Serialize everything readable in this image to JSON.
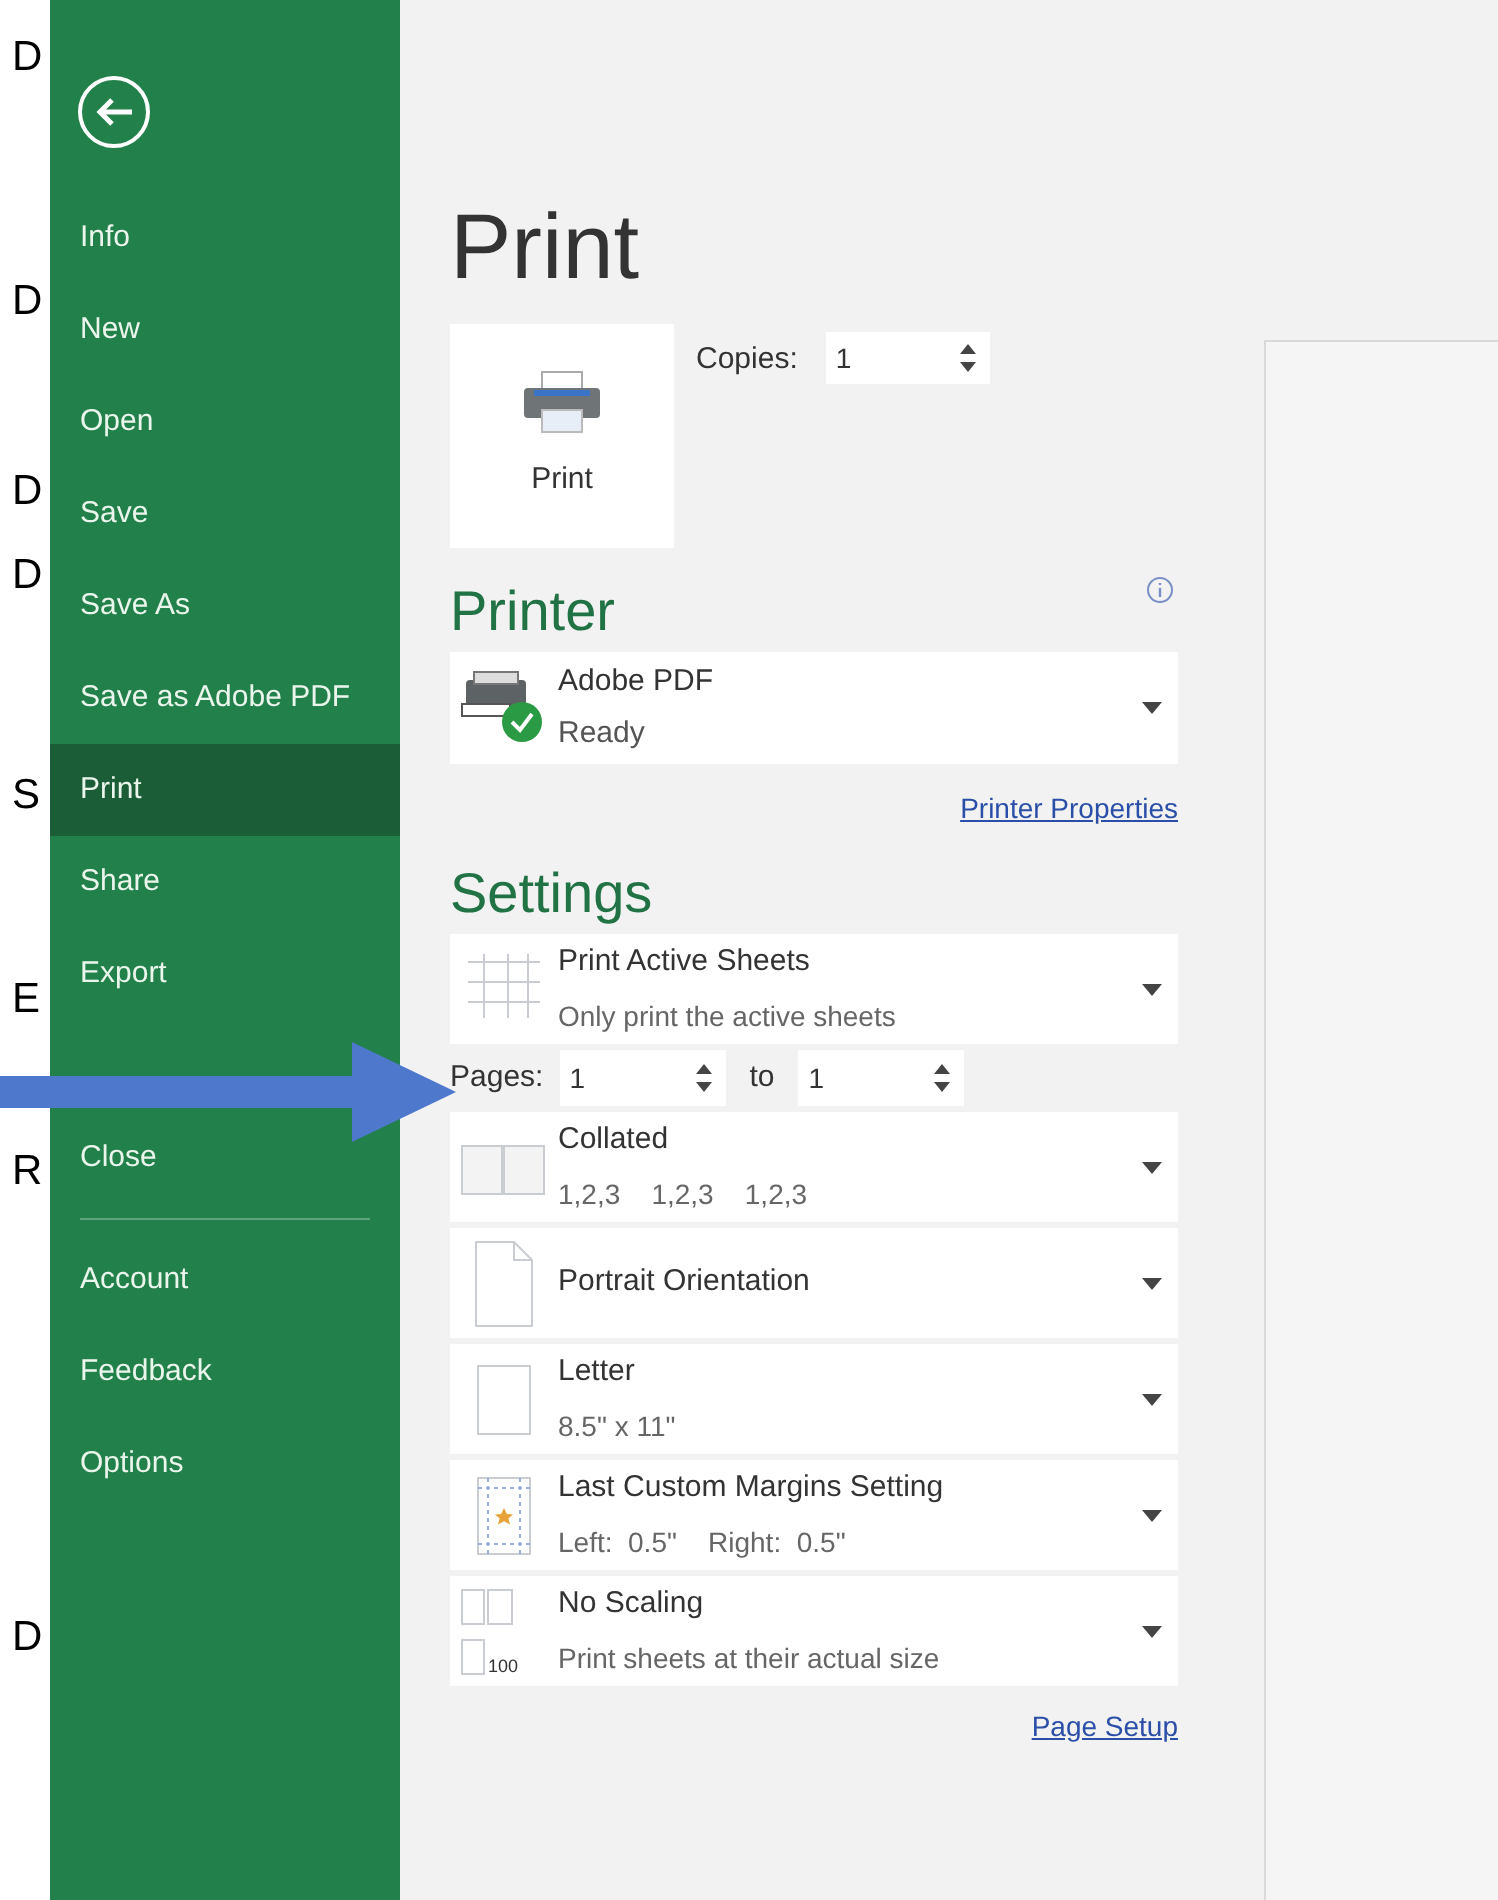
{
  "sheet_column": [
    "D",
    "D",
    "D",
    "D",
    "S",
    "E",
    "R",
    "D"
  ],
  "backstage_menu": {
    "items": [
      {
        "label": "Info",
        "selected": false
      },
      {
        "label": "New",
        "selected": false
      },
      {
        "label": "Open",
        "selected": false
      },
      {
        "label": "Save",
        "selected": false
      },
      {
        "label": "Save As",
        "selected": false
      },
      {
        "label": "Save as Adobe PDF",
        "selected": false
      },
      {
        "label": "Print",
        "selected": true
      },
      {
        "label": "Share",
        "selected": false
      },
      {
        "label": "Export",
        "selected": false
      },
      {
        "label": "Close",
        "selected": false
      }
    ],
    "bottom_items": [
      {
        "label": "Account",
        "selected": false
      },
      {
        "label": "Feedback",
        "selected": false
      },
      {
        "label": "Options",
        "selected": false
      }
    ]
  },
  "title": "Print",
  "print_button": {
    "label": "Print"
  },
  "copies": {
    "label": "Copies:",
    "value": "1"
  },
  "printer": {
    "heading": "Printer",
    "name": "Adobe PDF",
    "status": "Ready",
    "properties_link": "Printer Properties"
  },
  "settings": {
    "heading": "Settings",
    "items": [
      {
        "kind": "dropdown",
        "title": "Print Active Sheets",
        "subtitle": "Only print the active sheets"
      },
      {
        "kind": "range",
        "label": "Pages:",
        "from": "1",
        "separator": "to",
        "to": "1"
      },
      {
        "kind": "dropdown",
        "title": "Collated",
        "subtitle": "1,2,3    1,2,3    1,2,3"
      },
      {
        "kind": "dropdown",
        "title": "Portrait Orientation"
      },
      {
        "kind": "dropdown",
        "title": "Letter",
        "subtitle": "8.5\" x 11\""
      },
      {
        "kind": "dropdown",
        "title": "Last Custom Margins Setting",
        "subtitle": "Left:  0.5\"    Right:  0.5\""
      },
      {
        "kind": "dropdown",
        "icon_text": "100",
        "title": "No Scaling",
        "subtitle": "Print sheets at their actual size"
      }
    ],
    "page_setup_link": "Page Setup"
  }
}
